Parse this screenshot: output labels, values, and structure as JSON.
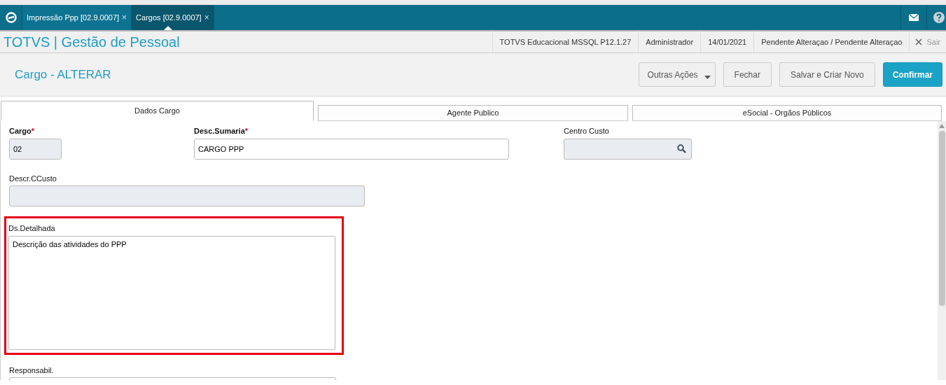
{
  "app_tabs": [
    {
      "label": "Impressão Ppp [02.9.0007]",
      "close": "×",
      "selected": false
    },
    {
      "label": "Cargos [02.9.0007]",
      "close": "×",
      "selected": true
    }
  ],
  "header": {
    "title": "TOTVS | Gestão de Pessoal",
    "info": [
      "TOTVS Educacional MSSQL P12.1.27",
      "Administrador",
      "14/01/2021",
      "Pendente Alteraçao / Pendente Alteraçao"
    ],
    "exit": "Sair"
  },
  "page": {
    "title": "Cargo - ALTERAR",
    "buttons": [
      {
        "label": "Outras Ações",
        "kind": "dropdown"
      },
      {
        "label": "Fechar",
        "kind": "default"
      },
      {
        "label": "Salvar e Criar Novo",
        "kind": "default"
      },
      {
        "label": "Confirmar",
        "kind": "primary"
      }
    ]
  },
  "form_tabs": [
    {
      "label": "Dados Cargo",
      "selected": true
    },
    {
      "label": "Agente Publico",
      "selected": false
    },
    {
      "label": "eSocial - Orgãos Públicos",
      "selected": false
    }
  ],
  "fields": [
    {
      "label": "Cargo",
      "kind": "input",
      "required_mark": "*",
      "disabled": true,
      "value": "02",
      "highlighted": false
    },
    {
      "label": "Desc.Sumaria",
      "kind": "input",
      "required_mark": "*",
      "disabled": false,
      "value": "CARGO PPP",
      "highlighted": false
    },
    {
      "label": "Centro Custo",
      "kind": "lookup",
      "disabled": true,
      "highlighted": false
    },
    {
      "label": "Descr.CCusto",
      "kind": "input",
      "disabled": true,
      "highlighted": false
    },
    {
      "label": "Ds.Detalhada",
      "kind": "textarea",
      "disabled": false,
      "value": "Descrição das atividades do PPP",
      "highlighted": true
    },
    {
      "label": "Responsabil.",
      "kind": "textarea",
      "disabled": false,
      "highlighted": false
    }
  ]
}
